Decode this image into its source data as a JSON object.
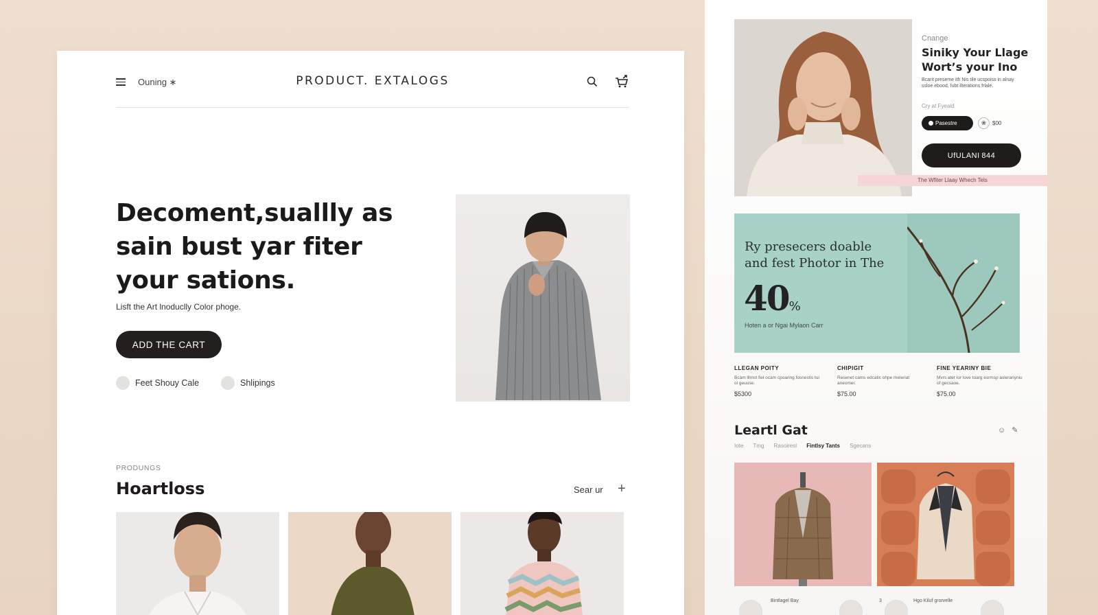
{
  "header": {
    "menu_label": "Ouning ∗",
    "brand": "PRODUCT. EXTALOGS"
  },
  "hero": {
    "title_lines": [
      "Decoment,suallly as",
      "sain bust yar fiter",
      "your sations."
    ],
    "subtitle": "Lisft the Art lnoduclly Color phoge.",
    "cta_label": "ADD THE CART",
    "features": [
      "Feet Shouy Cale",
      "Shlipings"
    ]
  },
  "products": {
    "kicker": "PRODUNGS",
    "title": "Hoartloss",
    "search_label": "Sear ur",
    "plus_label": "+"
  },
  "right": {
    "kicker": "Cnange",
    "title_lines": [
      "Siniky Your Llage",
      "Wort’s your Ino"
    ],
    "description": "Bcarit preseme ith Nis tile ucspoiss in alnay ssloe ebood, fubt ilterations frlale.",
    "caption": "Cry at Fyeald",
    "pill_label": "Pasestre",
    "pin_label": "❀",
    "price": "$00",
    "cta_label": "UfULANI 844",
    "strip_text": "The Wfiter Llaay  Whech Tels"
  },
  "promo": {
    "lines": [
      "Ry presecers doable",
      "and fest Photor in The"
    ],
    "percent": "40",
    "percent_sign": "%",
    "note": "Hoten a or Ngai Mylaon Carr"
  },
  "features_cols": [
    {
      "heading": "LLEGAN POITY",
      "desc": "Bcam lllmst fiel ocam cpoaring fosnestis tui ol geuuse.",
      "price": "$5300"
    },
    {
      "heading": "CHIPIGIT",
      "desc": "Resenet cams edcatic ohpe meleriat aneomer.",
      "price": "$75.00"
    },
    {
      "heading": "FINE YEARINY BIE",
      "desc": "Mvrs ater lor love toarg esrmsp asleranyniu of gecsaoe.",
      "price": "$75.00"
    }
  ],
  "gallery": {
    "title": "Leartl Gat",
    "tabs": [
      "Iote",
      "Tmg",
      "Rasoiresl",
      "Fintlsy Tants",
      "Sgecans"
    ],
    "active_tab": 3,
    "icons": [
      "user-icon",
      "pen-icon"
    ],
    "bottom_labels": [
      "Bintlagel Bay",
      "Hgo Kiluf grorvelle"
    ],
    "bottom_numbers": [
      "3"
    ]
  },
  "colors": {
    "background": "#ecdccb",
    "accent_dark": "#221f1e",
    "promo_teal": "#a8d2c7",
    "strip_pink": "#f6d6d4",
    "tile_pink": "#e8b8b6",
    "tile_orange": "#d87e57"
  }
}
